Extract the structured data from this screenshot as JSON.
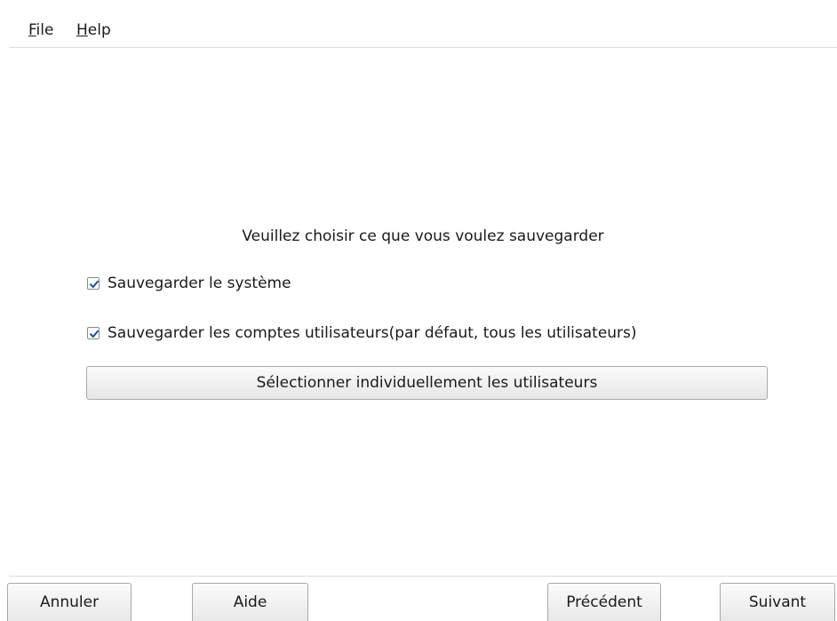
{
  "menubar": {
    "file": {
      "mnemonic": "F",
      "rest": "ile"
    },
    "help": {
      "mnemonic": "H",
      "rest": "elp"
    }
  },
  "prompt": "Veuillez choisir ce que vous voulez sauvegarder",
  "options": [
    {
      "label": "Sauvegarder le système",
      "checked": true
    },
    {
      "label": "Sauvegarder les comptes utilisateurs(par défaut, tous les utilisateurs)",
      "checked": true
    }
  ],
  "select_users_label": "Sélectionner individuellement les utilisateurs",
  "buttons": {
    "cancel": "Annuler",
    "help": "Aide",
    "previous": "Précédent",
    "next": "Suivant"
  }
}
